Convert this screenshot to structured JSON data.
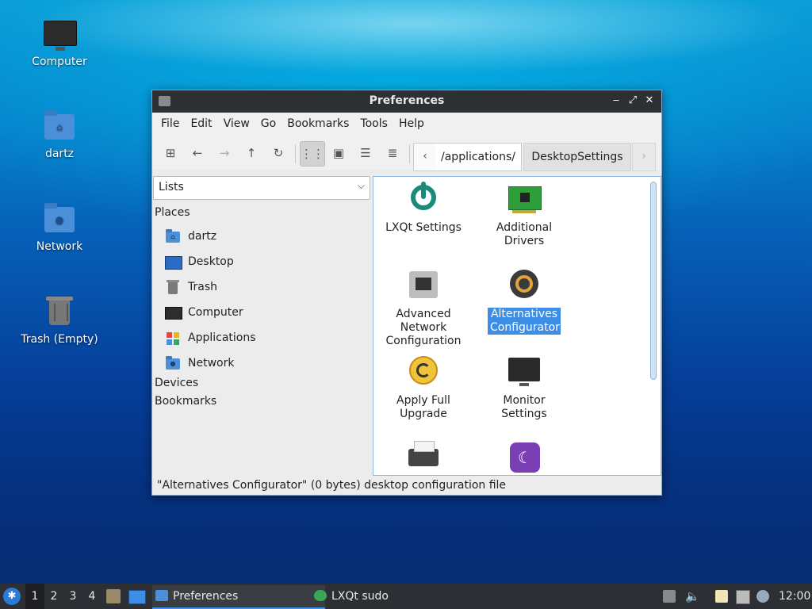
{
  "desktop": {
    "icons": [
      {
        "label": "Computer"
      },
      {
        "label": "dartz"
      },
      {
        "label": "Network"
      },
      {
        "label": "Trash (Empty)"
      }
    ]
  },
  "window": {
    "title": "Preferences",
    "controls": {
      "minimize": "‒",
      "maximize": "⤢",
      "close": "✕"
    },
    "menu": [
      "File",
      "Edit",
      "View",
      "Go",
      "Bookmarks",
      "Tools",
      "Help"
    ],
    "path": {
      "current": "/applications/",
      "next": "DesktopSettings"
    },
    "side": {
      "mode": "Lists",
      "places_title": "Places",
      "places": [
        "dartz",
        "Desktop",
        "Trash",
        "Computer",
        "Applications",
        "Network"
      ],
      "devices_title": "Devices",
      "bookmarks_title": "Bookmarks"
    },
    "items": [
      {
        "label": "LXQt Settings"
      },
      {
        "label": "Additional Drivers"
      },
      {
        "label": "Advanced Network Configuration"
      },
      {
        "label": "Alternatives Configurator"
      },
      {
        "label": "Apply Full Upgrade"
      },
      {
        "label": "Monitor Settings"
      }
    ],
    "status": "\"Alternatives Configurator\" (0 bytes) desktop configuration file"
  },
  "taskbar": {
    "workspaces": [
      "1",
      "2",
      "3",
      "4"
    ],
    "tasks": [
      "Preferences",
      "LXQt sudo"
    ],
    "clock": "12:00"
  },
  "colors": {
    "selection": "#3d8ee6",
    "titlebar": "#2c2f33"
  }
}
